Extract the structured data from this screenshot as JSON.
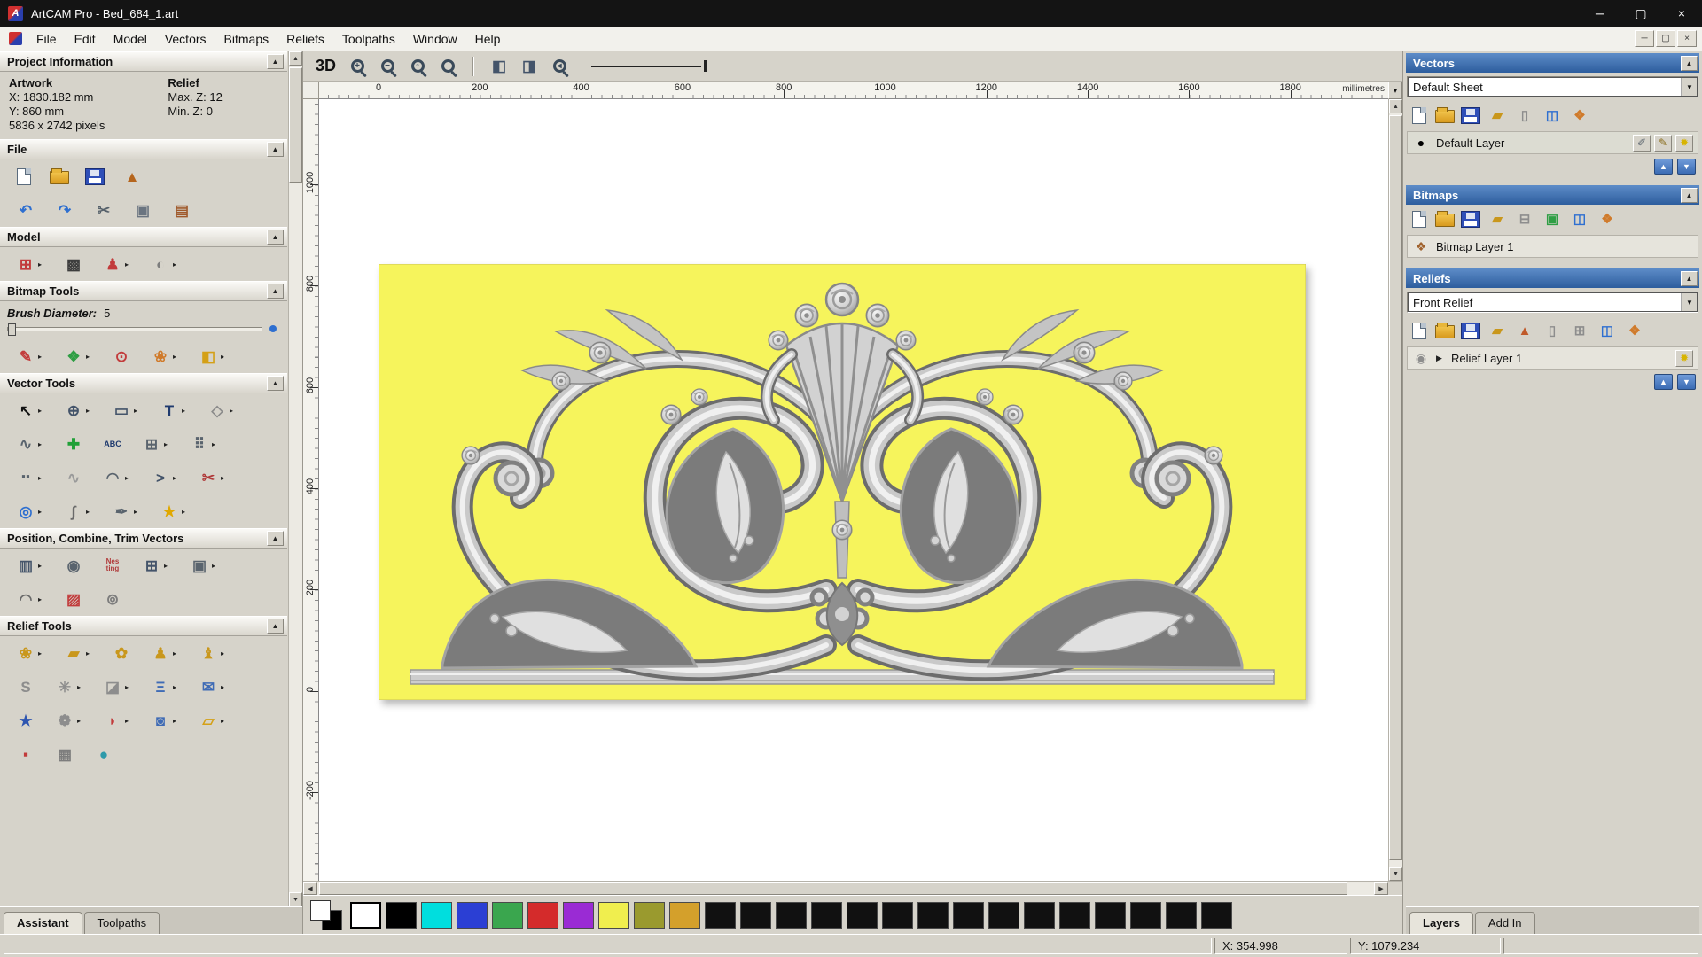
{
  "window": {
    "title": "ArtCAM Pro - Bed_684_1.art",
    "controls": [
      {
        "n": "minimize-button",
        "g": "─"
      },
      {
        "n": "maximize-button",
        "g": "▢"
      },
      {
        "n": "close-button",
        "g": "×"
      }
    ],
    "mdi_controls": [
      {
        "n": "mdi-minimize-button",
        "g": "─"
      },
      {
        "n": "mdi-restore-button",
        "g": "▢"
      },
      {
        "n": "mdi-close-button",
        "g": "×"
      }
    ]
  },
  "menu": {
    "items": [
      "File",
      "Edit",
      "Model",
      "Vectors",
      "Bitmaps",
      "Reliefs",
      "Toolpaths",
      "Window",
      "Help"
    ]
  },
  "assistant": {
    "project_info": {
      "header": "Project Information",
      "artwork_label": "Artwork",
      "relief_label": "Relief",
      "x": "X: 1830.182 mm",
      "y": "Y: 860 mm",
      "pixels": "5836 x 2742 pixels",
      "max_z": "Max. Z: 12",
      "min_z": "Min. Z: 0"
    },
    "sections": [
      {
        "id": "file",
        "label": "File",
        "rows": [
          [
            {
              "n": "new-model-button",
              "k": "page"
            },
            {
              "n": "open-model-button",
              "k": "folder"
            },
            {
              "n": "save-model-button",
              "k": "floppy"
            },
            {
              "n": "import-model-button",
              "g": "▲",
              "c": "#b5651d"
            }
          ],
          [
            {
              "n": "undo-button",
              "g": "↶",
              "c": "#2e6fd0"
            },
            {
              "n": "redo-button",
              "g": "↷",
              "c": "#2e6fd0"
            },
            {
              "n": "cut-button",
              "g": "✂",
              "c": "#55606a"
            },
            {
              "n": "copy-button",
              "g": "▣",
              "c": "#6a7480"
            },
            {
              "n": "paste-button",
              "g": "▤",
              "c": "#a05a2c"
            }
          ]
        ]
      },
      {
        "id": "model",
        "label": "Model",
        "rows": [
          [
            {
              "n": "set-model-size-button",
              "g": "⊞",
              "c": "#c23b3b",
              "a": 1
            },
            {
              "n": "adjust-model-button",
              "g": "▩",
              "c": "#3d3d3d"
            },
            {
              "n": "model-figure-button",
              "g": "♟",
              "c": "#c23b3b",
              "a": 1
            },
            {
              "n": "model-lighting-button",
              "g": "◐",
              "c": "#7d7d7d",
              "a": 1
            }
          ]
        ]
      },
      {
        "id": "bitmap",
        "label": "Bitmap Tools",
        "brush": {
          "label": "Brush Diameter:",
          "value": "5"
        },
        "rows": [
          [
            {
              "n": "paint-button",
              "g": "✎",
              "c": "#c23b3b",
              "a": 1
            },
            {
              "n": "paint-selective-button",
              "g": "❖",
              "c": "#2f9e44",
              "a": 1
            },
            {
              "n": "colour-picker-button",
              "g": "⊙",
              "c": "#c23b3b"
            },
            {
              "n": "palette-button",
              "g": "❀",
              "c": "#d07a2a",
              "a": 1
            },
            {
              "n": "flood-fill-button",
              "g": "◧",
              "c": "#d4a017",
              "a": 1
            }
          ]
        ]
      },
      {
        "id": "vector",
        "label": "Vector Tools",
        "rows": [
          [
            {
              "n": "select-vectors-button",
              "g": "↖",
              "c": "#111111",
              "a": 1
            },
            {
              "n": "transform-vectors-button",
              "g": "⊕",
              "c": "#44546a",
              "a": 1
            },
            {
              "n": "create-rectangle-button",
              "g": "▭",
              "c": "#44546a",
              "a": 1
            },
            {
              "n": "create-text-button",
              "g": "T",
              "c": "#1f3a6e",
              "a": 1
            },
            {
              "n": "measure-button",
              "g": "◇",
              "c": "#8a8a8a",
              "a": 1
            }
          ],
          [
            {
              "n": "create-polyline-button",
              "g": "∿",
              "c": "#5a646e",
              "a": 1
            },
            {
              "n": "node-editing-button",
              "g": "✚",
              "c": "#21a038"
            },
            {
              "n": "vector-text-button",
              "g": "ABC",
              "c": "#1f3a6e",
              "fs": 9
            },
            {
              "n": "paste-along-curve-button",
              "g": "⊞",
              "c": "#5a646e",
              "a": 1
            },
            {
              "n": "block-array-button",
              "g": "⠿",
              "c": "#5a646e",
              "a": 1
            }
          ],
          [
            {
              "n": "create-dots-button",
              "g": "⠒",
              "c": "#5a646e",
              "a": 1
            },
            {
              "n": "free-polyline-button",
              "g": "∿",
              "c": "#9a9a9a"
            },
            {
              "n": "bezier-editing-button",
              "g": "◠",
              "c": "#5a646e",
              "a": 1
            },
            {
              "n": "create-arc-button",
              "g": ">",
              "c": "#44546a",
              "a": 1
            },
            {
              "n": "trim-vectors-button",
              "g": "✂",
              "c": "#b03a3a",
              "a": 1
            }
          ],
          [
            {
              "n": "wrap-vectors-button",
              "g": "◎",
              "c": "#2e6fd0",
              "a": 1
            },
            {
              "n": "fit-curve-button",
              "g": "∫",
              "c": "#6a6a6a",
              "a": 1
            },
            {
              "n": "close-vector-button",
              "g": "✒",
              "c": "#5a646e",
              "a": 1
            },
            {
              "n": "create-star-button",
              "g": "★",
              "c": "#e0a800",
              "a": 1
            }
          ]
        ]
      },
      {
        "id": "position",
        "label": "Position, Combine, Trim Vectors",
        "rows": [
          [
            {
              "n": "align-vectors-button",
              "g": "▥",
              "c": "#44546a",
              "a": 1
            },
            {
              "n": "circular-copy-button",
              "g": "◉",
              "c": "#5a646e"
            },
            {
              "n": "nesting-button",
              "g": "Nes ting",
              "c": "#b03a3a",
              "fs": 8
            },
            {
              "n": "block-copy-button",
              "g": "⊞",
              "c": "#44546a",
              "a": 1
            },
            {
              "n": "rotate-copy-button",
              "g": "▣",
              "c": "#5a646e",
              "a": 1
            }
          ],
          [
            {
              "n": "fillet-tool-button",
              "g": "◠",
              "c": "#6a6a6a",
              "a": 1
            },
            {
              "n": "weld-vectors-button",
              "g": "▨",
              "c": "#c23b3b"
            },
            {
              "n": "spiral-tool-button",
              "g": "⊚",
              "c": "#7d7d7d"
            }
          ]
        ]
      },
      {
        "id": "relief",
        "label": "Relief Tools",
        "rows": [
          [
            {
              "n": "shape-editor-button",
              "g": "❀",
              "c": "#c9971c",
              "a": 1
            },
            {
              "n": "smoothing-button",
              "g": "▰",
              "c": "#c9971c",
              "a": 1
            },
            {
              "n": "sculpting-button",
              "g": "✿",
              "c": "#c9971c"
            },
            {
              "n": "add-relief-button",
              "g": "♟",
              "c": "#c9971c",
              "a": 1
            },
            {
              "n": "angel-relief-button",
              "g": "♝",
              "c": "#c9971c",
              "a": 1
            }
          ],
          [
            {
              "n": "profile-button",
              "g": "S",
              "c": "#8d8d8d"
            },
            {
              "n": "weave-wizard-button",
              "g": "✳",
              "c": "#8d8d8d",
              "a": 1
            },
            {
              "n": "extrude-button",
              "g": "◪",
              "c": "#8d8d8d",
              "a": 1
            },
            {
              "n": "two-rail-sweep-button",
              "g": "Ξ",
              "c": "#3f6bb5",
              "a": 1
            },
            {
              "n": "envelope-button",
              "g": "✉",
              "c": "#3f6bb5",
              "a": 1
            }
          ],
          [
            {
              "n": "star-relief-button",
              "g": "★",
              "c": "#2e55b0"
            },
            {
              "n": "swirl-relief-button",
              "g": "❁",
              "c": "#8d8d8d",
              "a": 1
            },
            {
              "n": "fan-relief-button",
              "g": "◗",
              "c": "#c23b3b",
              "a": 1
            },
            {
              "n": "texture-relief-button",
              "g": "◙",
              "c": "#3f6bb5",
              "a": 1
            },
            {
              "n": "offset-relief-button",
              "g": "▱",
              "c": "#d4a017",
              "a": 1
            }
          ],
          [
            {
              "n": "clipart-button",
              "g": "▪",
              "c": "#c23b3b"
            },
            {
              "n": "basket-weave-button",
              "g": "▦",
              "c": "#7d7d7d"
            },
            {
              "n": "sphere-texture-button",
              "g": "●",
              "c": "#2e9aaa"
            }
          ]
        ]
      }
    ],
    "tabs": [
      {
        "label": "Assistant",
        "active": true
      },
      {
        "label": "Toolpaths",
        "active": false
      }
    ]
  },
  "canvas": {
    "toolbar": {
      "items": [
        {
          "n": "view-3d-button",
          "t": "3D"
        },
        {
          "n": "zoom-in-button",
          "mag": "+"
        },
        {
          "n": "zoom-out-button",
          "mag": "−"
        },
        {
          "n": "zoom-box-button",
          "mag": "▫"
        },
        {
          "n": "zoom-100-button",
          "mag": ""
        },
        {
          "sep": 1
        },
        {
          "n": "zoom-objects-button",
          "g": "◧",
          "c": "#44546a"
        },
        {
          "n": "zoom-sheet-button",
          "g": "◨",
          "c": "#44546a"
        },
        {
          "n": "zoom-previous-button",
          "mag": "◂"
        },
        {
          "line": 1,
          "n": "line-preview-slider"
        }
      ]
    },
    "rulers": {
      "h": {
        "labels": [
          "0",
          "200",
          "400",
          "600",
          "800",
          "1000",
          "1200",
          "1400",
          "1600",
          "1800"
        ],
        "unit": "millimetres"
      },
      "v": {
        "labels": [
          "1000",
          "800",
          "600",
          "400",
          "200",
          "0",
          "-200"
        ]
      }
    }
  },
  "right_panel": {
    "sections": [
      {
        "id": "vectors",
        "label": "Vectors",
        "combo": "Default Sheet",
        "toolbar": [
          {
            "n": "new-vector-layer-button",
            "k": "page"
          },
          {
            "n": "open-vector-layer-button",
            "k": "folder"
          },
          {
            "n": "save-vector-layer-button",
            "k": "floppy"
          },
          {
            "n": "import-vectors-button",
            "g": "▰",
            "c": "#c9971c"
          },
          {
            "n": "export-vectors-button",
            "g": "▯",
            "c": "#8d8d8d"
          },
          {
            "n": "delete-vector-layer-button",
            "g": "◫",
            "c": "#2e6fd0"
          },
          {
            "n": "merge-vector-layers-button",
            "g": "❖",
            "c": "#d07a2a"
          }
        ],
        "layers": [
          {
            "n": "vector-layer-row",
            "icon": {
              "g": "●",
              "c": "#000000"
            },
            "label": "Default Layer",
            "selected": true,
            "right": [
              {
                "n": "snap-toggle-icon",
                "g": "✐",
                "c": "#5a646e"
              },
              {
                "n": "edit-layer-icon",
                "g": "✎",
                "c": "#8a6d1c"
              },
              {
                "n": "layer-visibility-icon",
                "g": "✹",
                "c": "#d8b400"
              }
            ]
          }
        ],
        "updown": true
      },
      {
        "id": "bitmaps",
        "label": "Bitmaps",
        "toolbar": [
          {
            "n": "new-bitmap-layer-button",
            "k": "page"
          },
          {
            "n": "open-bitmap-layer-button",
            "k": "folder"
          },
          {
            "n": "save-bitmap-layer-button",
            "k": "floppy"
          },
          {
            "n": "import-bitmap-button",
            "g": "▰",
            "c": "#c9971c"
          },
          {
            "n": "combine-bitmap-button",
            "g": "⊟",
            "c": "#8d8d8d"
          },
          {
            "n": "bitmap-image-button",
            "g": "▣",
            "c": "#2f9e44"
          },
          {
            "n": "delete-bitmap-layer-button",
            "g": "◫",
            "c": "#2e6fd0"
          },
          {
            "n": "merge-bitmap-layers-button",
            "g": "❖",
            "c": "#d07a2a"
          }
        ],
        "layers": [
          {
            "n": "bitmap-layer-row",
            "icon": {
              "g": "❖",
              "c": "#a0622d"
            },
            "label": "Bitmap Layer 1",
            "right": []
          }
        ],
        "updown": false
      },
      {
        "id": "reliefs",
        "label": "Reliefs",
        "combo": "Front Relief",
        "toolbar": [
          {
            "n": "new-relief-layer-button",
            "k": "page"
          },
          {
            "n": "open-relief-layer-button",
            "k": "folder"
          },
          {
            "n": "save-relief-layer-button",
            "k": "floppy"
          },
          {
            "n": "import-relief-button",
            "g": "▰",
            "c": "#c9971c"
          },
          {
            "n": "relief-pyramid-button",
            "g": "▲",
            "c": "#c05a2a"
          },
          {
            "n": "relief-page-button",
            "g": "▯",
            "c": "#8d8d8d"
          },
          {
            "n": "relief-grid-button",
            "g": "⊞",
            "c": "#8d8d8d"
          },
          {
            "n": "delete-relief-layer-button",
            "g": "◫",
            "c": "#2e6fd0"
          },
          {
            "n": "merge-relief-layers-button",
            "g": "❖",
            "c": "#d07a2a"
          }
        ],
        "layers": [
          {
            "n": "relief-layer-row",
            "icon": {
              "g": "◉",
              "c": "#8d8d8d"
            },
            "expander": "▶",
            "label": "Relief Layer 1",
            "right": [
              {
                "n": "layer-visibility-icon",
                "g": "✹",
                "c": "#d8b400"
              }
            ]
          }
        ],
        "updown": true
      }
    ],
    "tabs": [
      {
        "label": "Layers",
        "active": true
      },
      {
        "label": "Add In",
        "active": false
      }
    ]
  },
  "palette": {
    "selected_index": 0,
    "colors": [
      "#ffffff",
      "#000000",
      "#00dede",
      "#2b3fd4",
      "#3aa64e",
      "#d42b2b",
      "#9a2bd4",
      "#f0ee4e",
      "#9a9a2e",
      "#d4a02b",
      "#111111",
      "#111111",
      "#111111",
      "#111111",
      "#111111",
      "#111111",
      "#111111",
      "#111111",
      "#111111",
      "#111111",
      "#111111",
      "#111111",
      "#111111",
      "#111111",
      "#111111"
    ]
  },
  "status": {
    "x_value": "X: 354.998",
    "y_value": "Y: 1079.234"
  }
}
